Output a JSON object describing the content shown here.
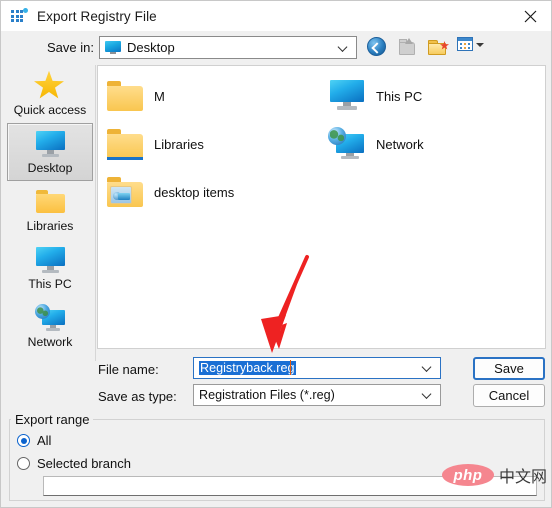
{
  "window": {
    "title": "Export Registry File",
    "icon": "registry-editor-icon",
    "close_label": "✕"
  },
  "savein": {
    "label": "Save in:",
    "value": "Desktop",
    "icon": "desktop-monitor-icon",
    "toolbar": [
      {
        "name": "back-button",
        "title": "Back"
      },
      {
        "name": "up-one-level-button",
        "title": "Up one level"
      },
      {
        "name": "new-folder-button",
        "title": "Create New Folder"
      },
      {
        "name": "views-button",
        "title": "Views"
      }
    ]
  },
  "places": {
    "items": [
      {
        "label": "Quick access",
        "icon": "star-icon",
        "selected": false
      },
      {
        "label": "Desktop",
        "icon": "monitor-icon",
        "selected": true
      },
      {
        "label": "Libraries",
        "icon": "folder-icon",
        "selected": false
      },
      {
        "label": "This PC",
        "icon": "monitor-icon",
        "selected": false
      },
      {
        "label": "Network",
        "icon": "network-icon",
        "selected": false
      }
    ]
  },
  "filelist": {
    "column_left": [
      {
        "label": "M",
        "icon": "folder-icon"
      },
      {
        "label": "Libraries",
        "icon": "folder-libraries-icon"
      },
      {
        "label": "desktop items",
        "icon": "folder-pictures-icon"
      }
    ],
    "column_right": [
      {
        "label": "This PC",
        "icon": "monitor-icon"
      },
      {
        "label": "Network",
        "icon": "network-icon"
      }
    ]
  },
  "form": {
    "filename_label": "File name:",
    "filename_value": "Registryback.reg",
    "filetype_label": "Save as type:",
    "filetype_value": "Registration Files (*.reg)",
    "save_button": "Save",
    "cancel_button": "Cancel"
  },
  "export_range": {
    "title": "Export range",
    "options": [
      {
        "label": "All",
        "selected": true
      },
      {
        "label": "Selected branch",
        "selected": false
      }
    ],
    "branch_value": ""
  },
  "annotation": {
    "arrow_color": "#ee2222",
    "arrow_target": "filename-field"
  },
  "watermark": {
    "php": "php",
    "cn": "中文网"
  },
  "colors": {
    "accent": "#2a72c4",
    "selection": "#1a6fd4",
    "dialog_bg": "#f0f0f0",
    "panel_bg": "#ffffff"
  }
}
